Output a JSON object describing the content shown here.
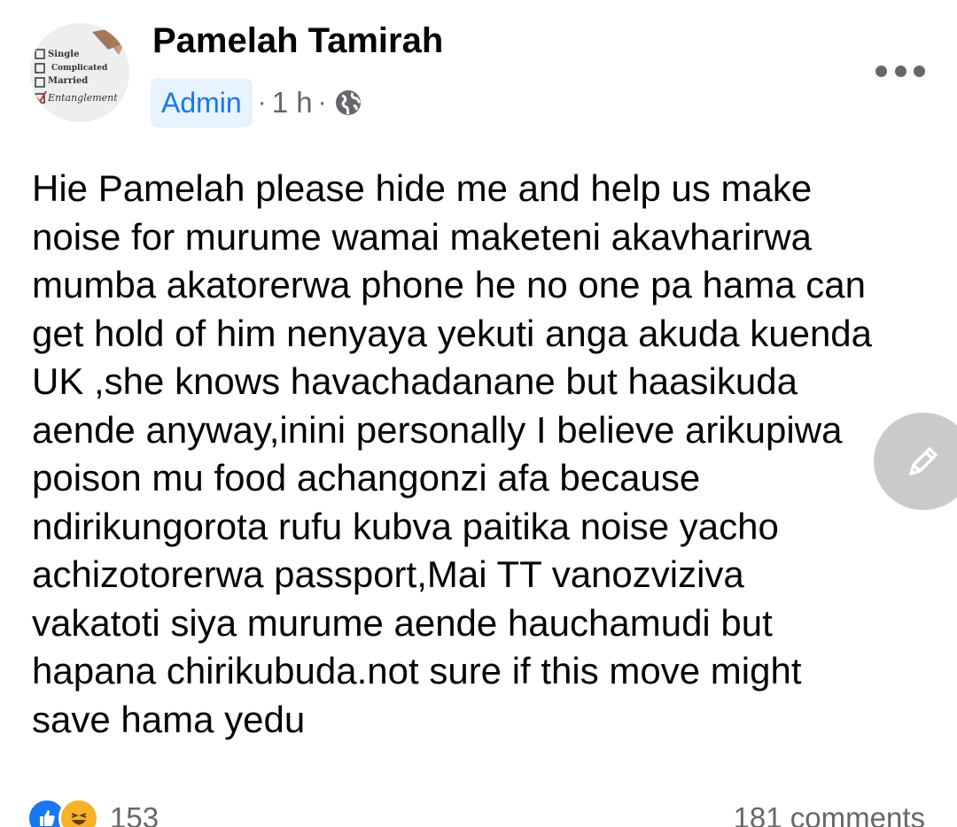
{
  "post": {
    "author": "Pamelah Tamirah",
    "badge": "Admin",
    "time": "1 h",
    "separator": "·",
    "avatar_text": {
      "line1": "Single",
      "line2": "Complicated",
      "line3": "Married",
      "line4": "Entanglement"
    },
    "body_lines": [
      "Hie Pamelah please hide me and help us make",
      "noise for murume wamai maketeni akavharirwa",
      "mumba akatorerwa phone he no one pa hama can",
      "get hold of him nenyaya yekuti anga akuda kuenda",
      "UK ,she knows havachadanane but haasikuda",
      "aende anyway,inini personally I believe arikupiwa",
      "poison mu food achangonzi afa because",
      "ndirikungorota rufu kubva paitika noise yacho",
      "achizotorerwa passport,Mai TT vanozviziva",
      "vakatoti siya murume aende hauchamudi but",
      "hapana chirikubuda.not sure if this move might",
      "save hama yedu"
    ],
    "reaction_count": "153",
    "comments_count": "181 comments"
  },
  "icons": {
    "more": "more-options-icon",
    "globe": "globe-icon",
    "edit": "edit-pencil-icon",
    "like": "like-reaction-icon",
    "haha": "haha-reaction-icon"
  },
  "colors": {
    "badge_bg": "#e7f3ff",
    "badge_text": "#1877f2",
    "meta_text": "#65676b",
    "like_blue": "#1877f2",
    "haha_yellow": "#f7b125",
    "fab_bg": "#c8cacc"
  }
}
